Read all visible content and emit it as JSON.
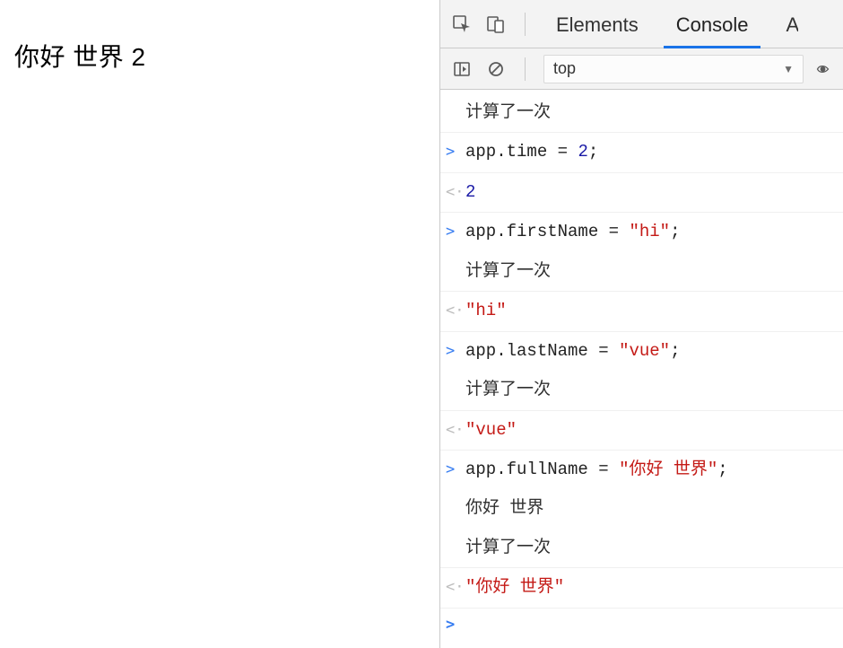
{
  "page": {
    "content": "你好 世界 2"
  },
  "tabs": {
    "elements": "Elements",
    "console": "Console",
    "more_cut": "A"
  },
  "filter": {
    "context": "top"
  },
  "console": {
    "lines": [
      {
        "kind": "log",
        "plain": "计算了一次"
      },
      {
        "kind": "in",
        "code_obj": "app",
        "code_prop": ".time",
        "code_op": " = ",
        "num": "2",
        "tail": ";"
      },
      {
        "kind": "out",
        "num": "2"
      },
      {
        "kind": "in",
        "code_obj": "app",
        "code_prop": ".firstName",
        "code_op": " = ",
        "str": "\"hi\"",
        "tail": ";"
      },
      {
        "kind": "log",
        "plain": "计算了一次"
      },
      {
        "kind": "out",
        "str": "\"hi\""
      },
      {
        "kind": "in",
        "code_obj": "app",
        "code_prop": ".lastName",
        "code_op": " = ",
        "str": "\"vue\"",
        "tail": ";"
      },
      {
        "kind": "log",
        "plain": "计算了一次"
      },
      {
        "kind": "out",
        "str": "\"vue\""
      },
      {
        "kind": "in",
        "code_obj": "app",
        "code_prop": ".fullName",
        "code_op": " = ",
        "str": "\"你好 世界\"",
        "tail": ";"
      },
      {
        "kind": "log",
        "plain": "你好 世界"
      },
      {
        "kind": "log",
        "plain": "计算了一次"
      },
      {
        "kind": "out",
        "str": "\"你好 世界\""
      }
    ]
  },
  "glyphs": {
    "in": ">",
    "out": "<·",
    "prompt": ">"
  }
}
